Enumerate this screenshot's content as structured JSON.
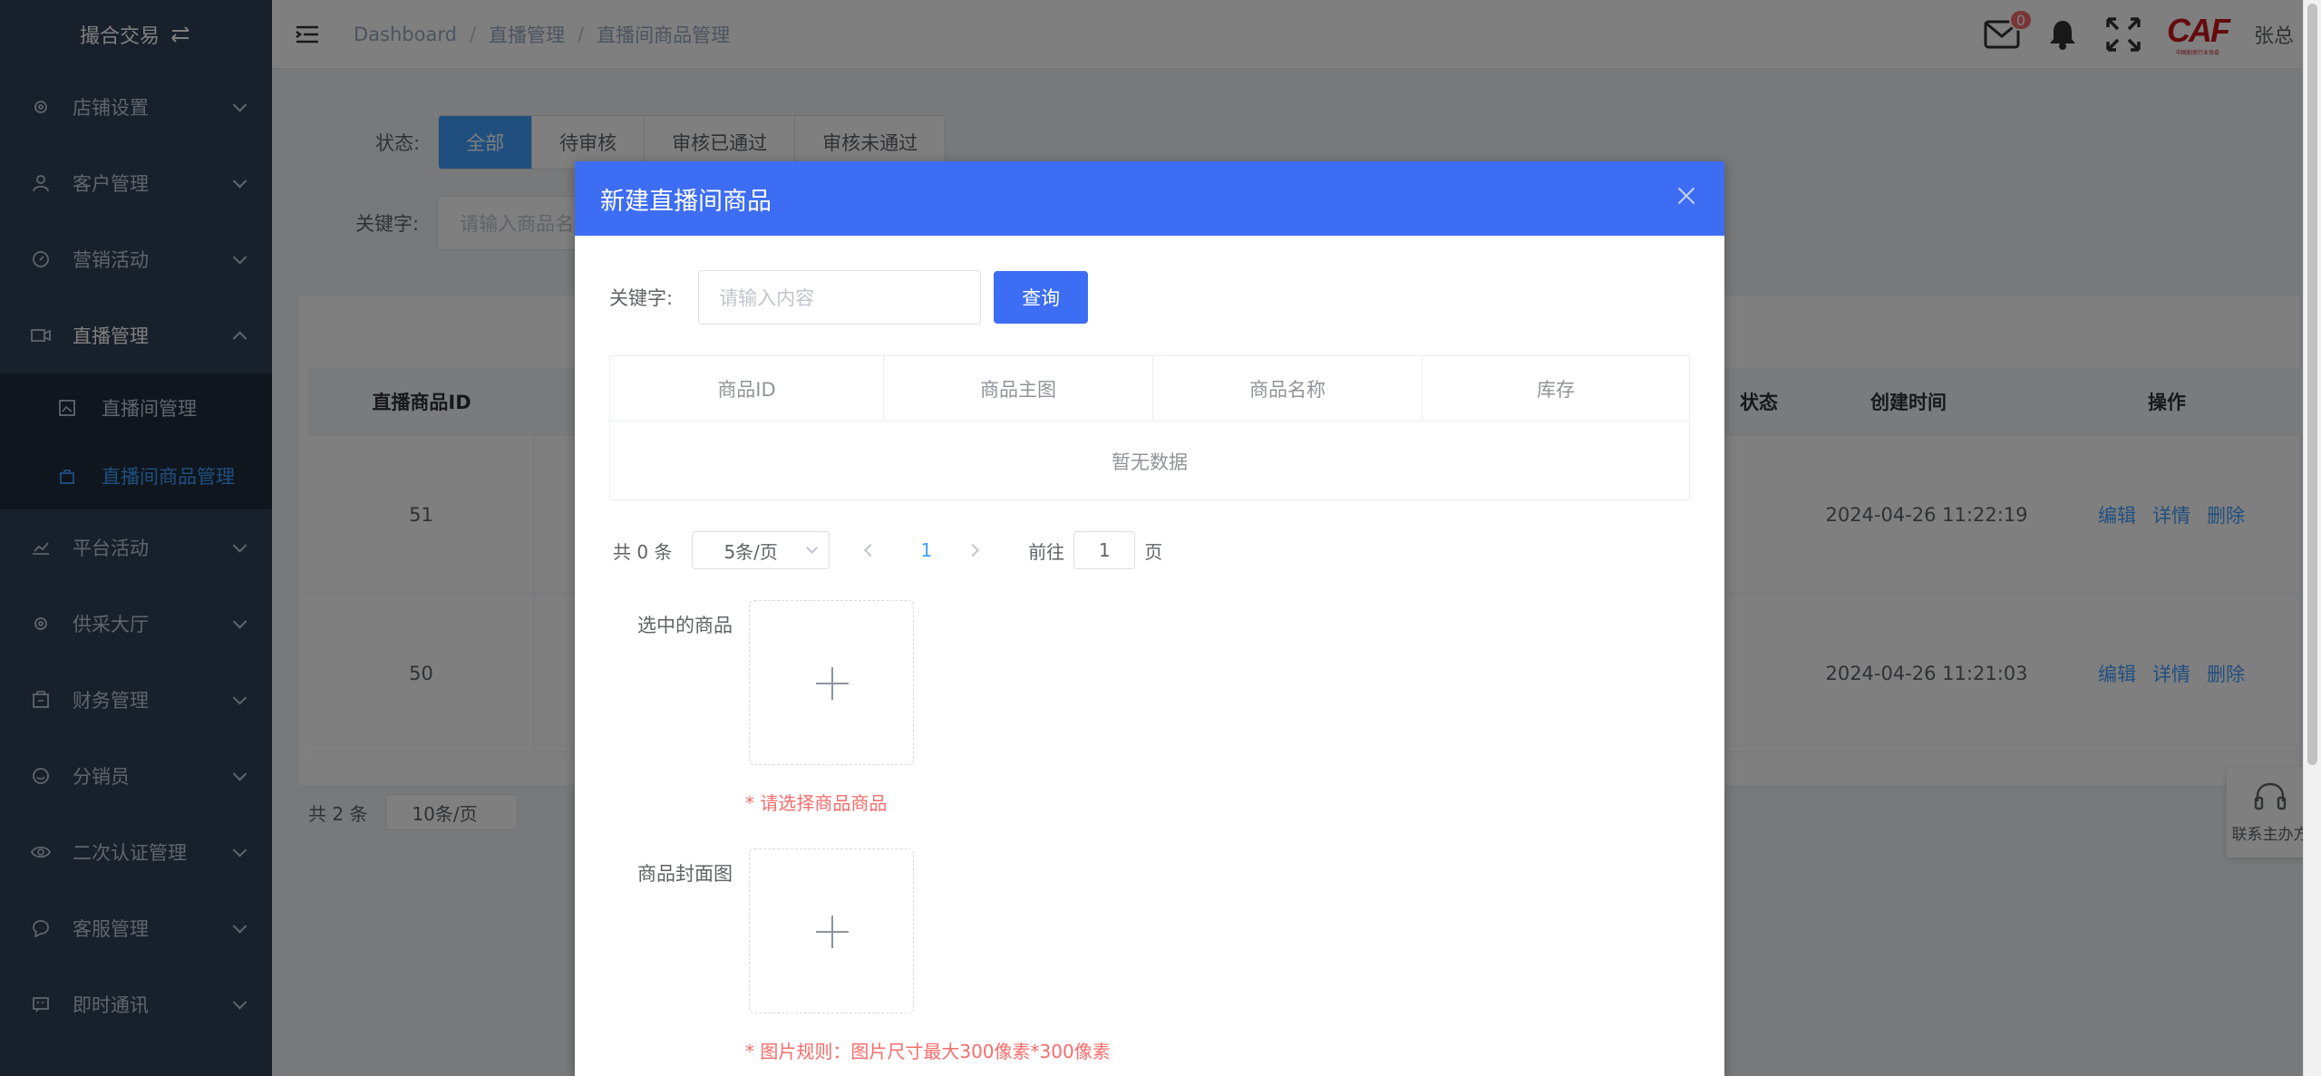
{
  "sidebar": {
    "brand": "撮合交易",
    "items": [
      {
        "label": "店铺设置",
        "icon": "gear-icon"
      },
      {
        "label": "客户管理",
        "icon": "user-icon"
      },
      {
        "label": "营销活动",
        "icon": "compass-icon"
      },
      {
        "label": "直播管理",
        "icon": "video-camera-icon"
      },
      {
        "label": "平台活动",
        "icon": "chart-icon"
      },
      {
        "label": "供采大厅",
        "icon": "gear-icon"
      },
      {
        "label": "财务管理",
        "icon": "wallet-icon"
      },
      {
        "label": "分销员",
        "icon": "smile-icon"
      },
      {
        "label": "二次认证管理",
        "icon": "eye-icon"
      },
      {
        "label": "客服管理",
        "icon": "chat-icon"
      },
      {
        "label": "即时通讯",
        "icon": "message-icon"
      }
    ],
    "subitems": [
      {
        "label": "直播间管理",
        "icon": "picture-icon"
      },
      {
        "label": "直播间商品管理",
        "icon": "bag-icon",
        "active": true
      }
    ]
  },
  "header": {
    "breadcrumb": [
      "Dashboard",
      "直播管理",
      "直播间商品管理"
    ],
    "mail_badge": "0",
    "logo_text": "CAF",
    "logo_sub": "中国拍卖行业协会",
    "username": "张总"
  },
  "main": {
    "status_label": "状态:",
    "status_tabs": [
      "全部",
      "待审核",
      "审核已通过",
      "审核未通过"
    ],
    "keyword_label": "关键字:",
    "keyword_placeholder": "请输入商品名称",
    "columns": {
      "id": "直播商品ID",
      "status": "状态",
      "created": "创建时间",
      "ops": "操作"
    },
    "rows": [
      {
        "id": "51",
        "created": "2024-04-26 11:22:19"
      },
      {
        "id": "50",
        "created": "2024-04-26 11:21:03"
      }
    ],
    "ops": {
      "edit": "编辑",
      "detail": "详情",
      "delete": "删除"
    },
    "total": "共 2 条",
    "page_size": "10条/页"
  },
  "contact": {
    "label": "联系主办方"
  },
  "dialog": {
    "title": "新建直播间商品",
    "keyword_label": "关键字:",
    "keyword_placeholder": "请输入内容",
    "search_button": "查询",
    "table_headers": [
      "商品ID",
      "商品主图",
      "商品名称",
      "库存"
    ],
    "empty_text": "暂无数据",
    "total": "共 0 条",
    "page_size": "5条/页",
    "current_page": "1",
    "goto_label": "前往",
    "goto_value": "1",
    "page_unit": "页",
    "selected_label": "选中的商品",
    "selected_error": "* 请选择商品商品",
    "cover_label": "商品封面图",
    "cover_rule": "* 图片规则：图片尺寸最大300像素*300像素"
  }
}
